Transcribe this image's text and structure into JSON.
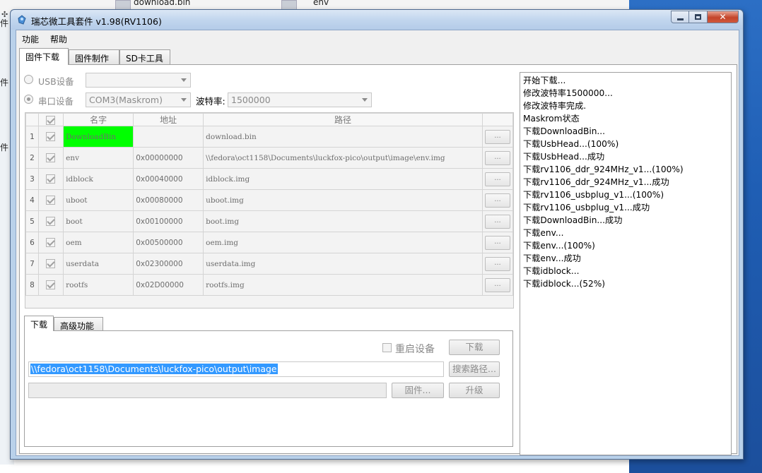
{
  "desktop": {
    "files": [
      {
        "label": "download.bin"
      },
      {
        "label": "env"
      }
    ],
    "side_chars": [
      "件",
      "件",
      "件"
    ]
  },
  "window": {
    "title": "瑞芯微工具套件 v1.98(RV1106)"
  },
  "menu": {
    "items": [
      "功能",
      "帮助"
    ]
  },
  "main_tabs": [
    "固件下载",
    "固件制作",
    "SD卡工具"
  ],
  "device": {
    "usb_label": "USB设备",
    "serial_label": "串口设备",
    "serial_port": "COM3(Maskrom)",
    "baud_label": "波特率:",
    "baud_value": "1500000"
  },
  "table": {
    "headers": [
      "",
      "名字",
      "地址",
      "路径",
      ""
    ],
    "browse_label": "...",
    "rows": [
      {
        "num": "1",
        "name": "DownloadBin",
        "addr": "",
        "path": "download.bin"
      },
      {
        "num": "2",
        "name": "env",
        "addr": "0x00000000",
        "path": "\\\\fedora\\oct1158\\Documents\\luckfox-pico\\output\\image\\env.img"
      },
      {
        "num": "3",
        "name": "idblock",
        "addr": "0x00040000",
        "path": "idblock.img"
      },
      {
        "num": "4",
        "name": "uboot",
        "addr": "0x00080000",
        "path": "uboot.img"
      },
      {
        "num": "5",
        "name": "boot",
        "addr": "0x00100000",
        "path": "boot.img"
      },
      {
        "num": "6",
        "name": "oem",
        "addr": "0x00500000",
        "path": "oem.img"
      },
      {
        "num": "7",
        "name": "userdata",
        "addr": "0x02300000",
        "path": "userdata.img"
      },
      {
        "num": "8",
        "name": "rootfs",
        "addr": "0x02D00000",
        "path": "rootfs.img"
      }
    ]
  },
  "bottom_tabs": [
    "下载",
    "高级功能"
  ],
  "download": {
    "reboot_label": "重启设备",
    "download_btn": "下载",
    "path_value": "\\\\fedora\\oct1158\\Documents\\luckfox-pico\\output\\image",
    "search_path_btn": "搜索路径...",
    "firmware_btn": "固件...",
    "upgrade_btn": "升级"
  },
  "log": {
    "lines": [
      "开始下载...",
      "修改波特率1500000...",
      "修改波特率完成.",
      "Maskrom状态",
      "下载DownloadBin...",
      "下载UsbHead...(100%)",
      "下载UsbHead...成功",
      "下载rv1106_ddr_924MHz_v1...(100%)",
      "下载rv1106_ddr_924MHz_v1...成功",
      "下载rv1106_usbplug_v1...(100%)",
      "下载rv1106_usbplug_v1...成功",
      "下载DownloadBin...成功",
      "下载env...",
      "下载env...(100%)",
      "下载env...成功",
      "下载idblock...",
      "下载idblock...(52%)"
    ]
  },
  "colors": {
    "selected_row_name": "#00ff00",
    "path_selection": "#3399ff",
    "desktop_blue": "#1f5eb4"
  }
}
